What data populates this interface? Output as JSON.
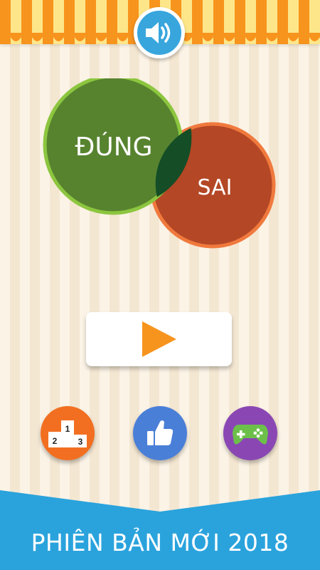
{
  "header": {
    "sound_icon": "speaker-volume-icon"
  },
  "logo": {
    "true_label": "ĐÚNG",
    "false_label": "SAI"
  },
  "play": {
    "icon": "play-triangle-icon"
  },
  "bottom_buttons": {
    "rank_icon": "leaderboard-podium-icon",
    "rank_labels": {
      "first": "1",
      "second": "2",
      "third": "3"
    },
    "like_icon": "thumbs-up-icon",
    "games_icon": "gamepad-icon"
  },
  "footer": {
    "banner_text": "PHIÊN BẢN MỚI 2018"
  },
  "colors": {
    "green": "#57832f",
    "red": "#b44725",
    "orange": "#f26f21",
    "blue": "#4a7fd8",
    "purple": "#8a47b4",
    "banner": "#2aa3dd"
  }
}
